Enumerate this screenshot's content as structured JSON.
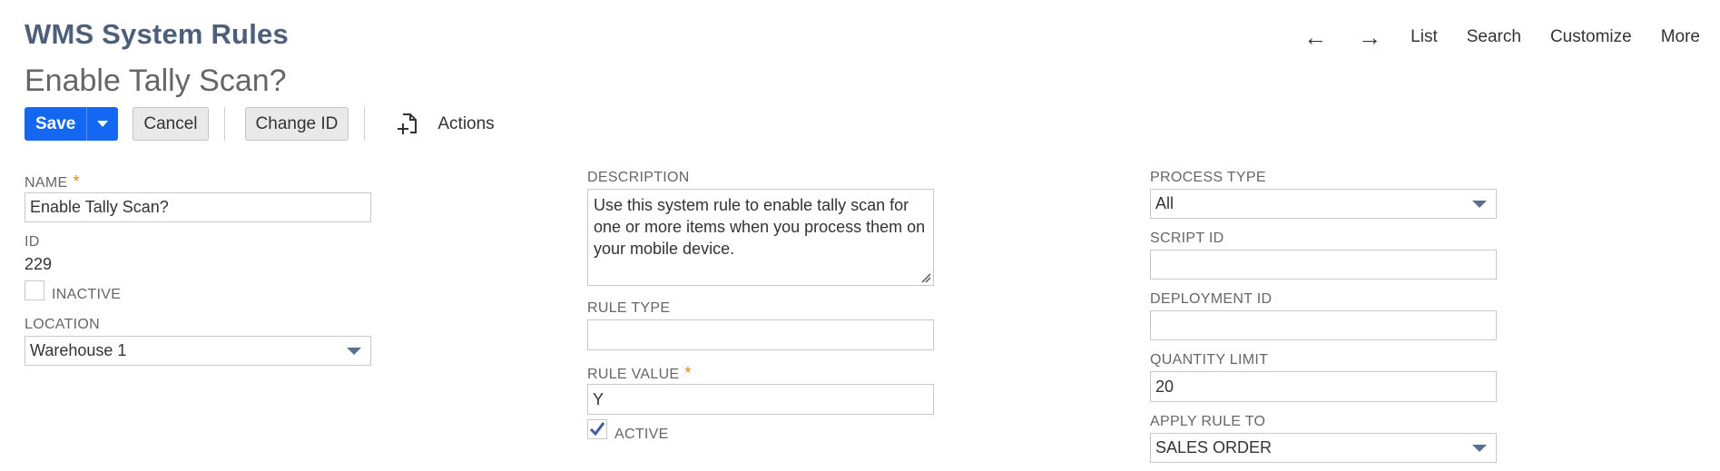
{
  "header": {
    "title": "WMS System Rules",
    "record_name": "Enable Tally Scan?",
    "nav": {
      "back": "←",
      "forward": "→",
      "list": "List",
      "search": "Search",
      "customize": "Customize",
      "more": "More"
    }
  },
  "toolbar": {
    "save_label": "Save",
    "cancel_label": "Cancel",
    "change_id_label": "Change ID",
    "actions_label": "Actions"
  },
  "form": {
    "name": {
      "label": "NAME",
      "required": "*",
      "value": "Enable Tally Scan?"
    },
    "id": {
      "label": "ID",
      "value": "229"
    },
    "inactive": {
      "label": "INACTIVE",
      "checked": false
    },
    "location": {
      "label": "LOCATION",
      "value": "Warehouse 1"
    },
    "description": {
      "label": "DESCRIPTION",
      "value": "Use this system rule to enable tally scan for one or more items when you process them on your mobile device."
    },
    "rule_type": {
      "label": "RULE TYPE",
      "value": ""
    },
    "rule_value": {
      "label": "RULE VALUE",
      "required": "*",
      "value": "Y"
    },
    "active": {
      "label": "ACTIVE",
      "checked": true
    },
    "process_type": {
      "label": "PROCESS TYPE",
      "value": "All"
    },
    "script_id": {
      "label": "SCRIPT ID",
      "value": ""
    },
    "deployment_id": {
      "label": "DEPLOYMENT ID",
      "value": ""
    },
    "quantity_limit": {
      "label": "QUANTITY LIMIT",
      "value": "20"
    },
    "apply_rule_to": {
      "label": "APPLY RULE TO",
      "value": "SALES ORDER"
    }
  },
  "colors": {
    "accent": "#1467f0",
    "title": "#4d5f79",
    "required": "#e08a00",
    "checkmark": "#3a5f9e"
  }
}
